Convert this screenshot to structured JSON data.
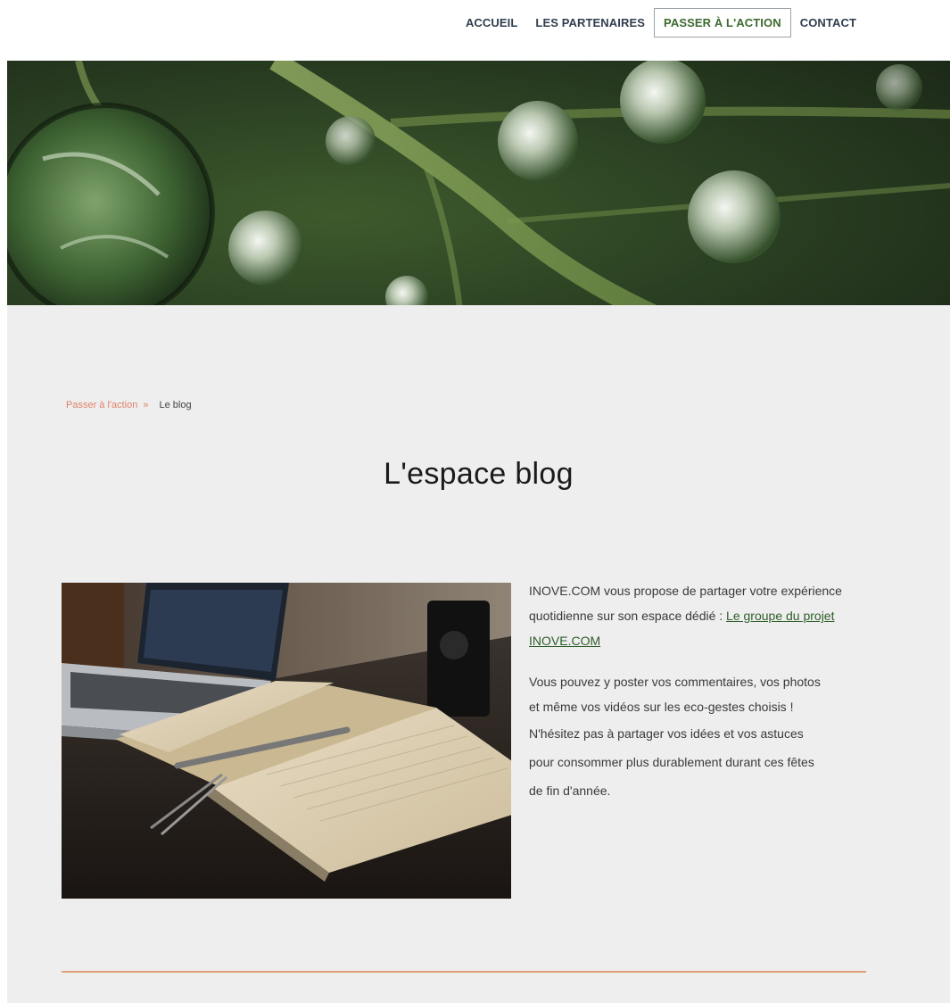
{
  "nav": {
    "items": [
      "ACCUEIL",
      "LES PARTENAIRES",
      "PASSER À L'ACTION",
      "CONTACT"
    ],
    "active_index": 2
  },
  "breadcrumb": {
    "parent": "Passer à l'action",
    "separator": "»",
    "current": "Le blog"
  },
  "page": {
    "title": "L'espace blog"
  },
  "content": {
    "p1_text": "INOVE.COM vous propose de partager votre expérience quotidienne sur son espace dédié : ",
    "p1_link": "Le groupe du projet INOVE.COM",
    "p2_lines": [
      "Vous pouvez y poster vos commentaires, vos photos",
      "et même vos vidéos sur les eco-gestes choisis !",
      "N'hésitez pas à partager vos idées et vos astuces",
      "pour consommer plus durablement durant ces fêtes",
      "de fin d'année."
    ]
  },
  "colors": {
    "accent": "#e0826a",
    "nav_active": "#3d6a2f",
    "divider": "#e0a07c",
    "section_bg": "#eeeeee"
  },
  "images": {
    "hero": "leaf with water droplets",
    "photo": "laptop, open notebook and pen on desk"
  }
}
